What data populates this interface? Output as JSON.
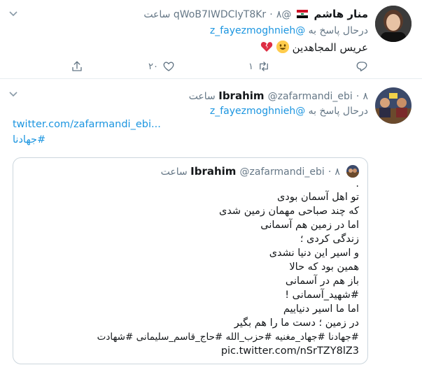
{
  "tweet1": {
    "display_name": "منار هاشم",
    "handle": "@qWoB7IWDCIyT8Kr",
    "dot": "·",
    "time": "۸ ساعت",
    "reply_prefix": "درحال پاسخ به",
    "reply_to": "@z_fayezmoghnieh",
    "text": "عریس المجاهدین",
    "reply_count": "",
    "retweet_count": "١",
    "like_count": "٢٠"
  },
  "tweet2": {
    "display_name": "Ibrahim",
    "handle": "@zafarmandi_ebi",
    "dot": "·",
    "time": "۸ ساعت",
    "reply_prefix": "درحال پاسخ به",
    "reply_to": "@z_fayezmoghnieh",
    "link": "twitter.com/zafarmandi_ebi...",
    "hashtag": "#جهادنا"
  },
  "quote": {
    "display_name": "Ibrahim",
    "handle": "@zafarmandi_ebi",
    "dot": "·",
    "time": "۸ ساعت",
    "lines": [
      ".",
      "تو اهل آسمان بودی",
      "که چند صباحی مهمان زمین شدی",
      "اما در زمین هم آسمانی",
      "زندگی کردی ؛",
      "و اسیر این دنیا نشدی",
      "همین بود که حالا",
      "باز هم در آسمانی",
      "#شهید_آسمانی !",
      "اما ما اسیر دنیاییم",
      "در زمین ؛ دست ما را هم بگیر",
      "#جهادنا #جهاد_مغنیه #حزب_الله #حاج_قاسم_سلیمانی #شهادت",
      "pic.twitter.com/nSrTZY8lZ3"
    ]
  },
  "icons": {
    "chevron": "chevron-down-icon",
    "reply": "reply-icon",
    "retweet": "retweet-icon",
    "like": "heart-icon",
    "share": "share-icon"
  },
  "colors": {
    "link": "#1b95e0",
    "muted": "#657786",
    "border": "#e6ecf0"
  }
}
